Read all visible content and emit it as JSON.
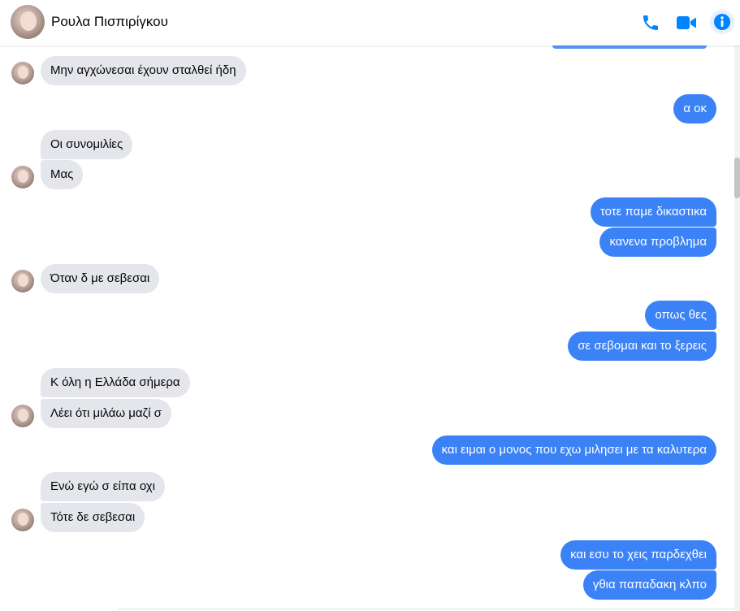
{
  "header": {
    "contact_name": "Ρουλα Πισπιρίγκου",
    "icons": [
      "phone-icon",
      "video-camera-icon",
      "info-icon"
    ],
    "accent_color": "#0084ff"
  },
  "colors": {
    "outgoing_bubble": "#3b82f6",
    "incoming_bubble": "#e4e6eb"
  },
  "messages": [
    {
      "from": "contact",
      "text": "Μην αγχώνεσαι έχουν σταλθεί ήδη"
    },
    {
      "from": "me",
      "text": "α οκ"
    },
    {
      "from": "contact",
      "text": "Οι συνομιλίες"
    },
    {
      "from": "contact",
      "text": "Μας"
    },
    {
      "from": "me",
      "text": "τοτε παμε δικαστικα"
    },
    {
      "from": "me",
      "text": "κανενα προβλημα"
    },
    {
      "from": "contact",
      "text": "Όταν δ με σεβεσαι"
    },
    {
      "from": "me",
      "text": "οπως θες"
    },
    {
      "from": "me",
      "text": "σε σεβομαι και το ξερεις"
    },
    {
      "from": "contact",
      "text": "Κ όλη η Ελλάδα σήμερα"
    },
    {
      "from": "contact",
      "text": "Λέει ότι μιλάω μαζί σ"
    },
    {
      "from": "me",
      "text": "και ειμαι ο μονος που εχω μιλησει με τα καλυτερα"
    },
    {
      "from": "contact",
      "text": "Ενώ εγώ σ είπα οχι"
    },
    {
      "from": "contact",
      "text": "Τότε δε σεβεσαι"
    },
    {
      "from": "me",
      "text": "και εσυ το χεις παρδεχθει"
    },
    {
      "from": "me",
      "text": "γθια παπαδακη κλπο"
    }
  ]
}
